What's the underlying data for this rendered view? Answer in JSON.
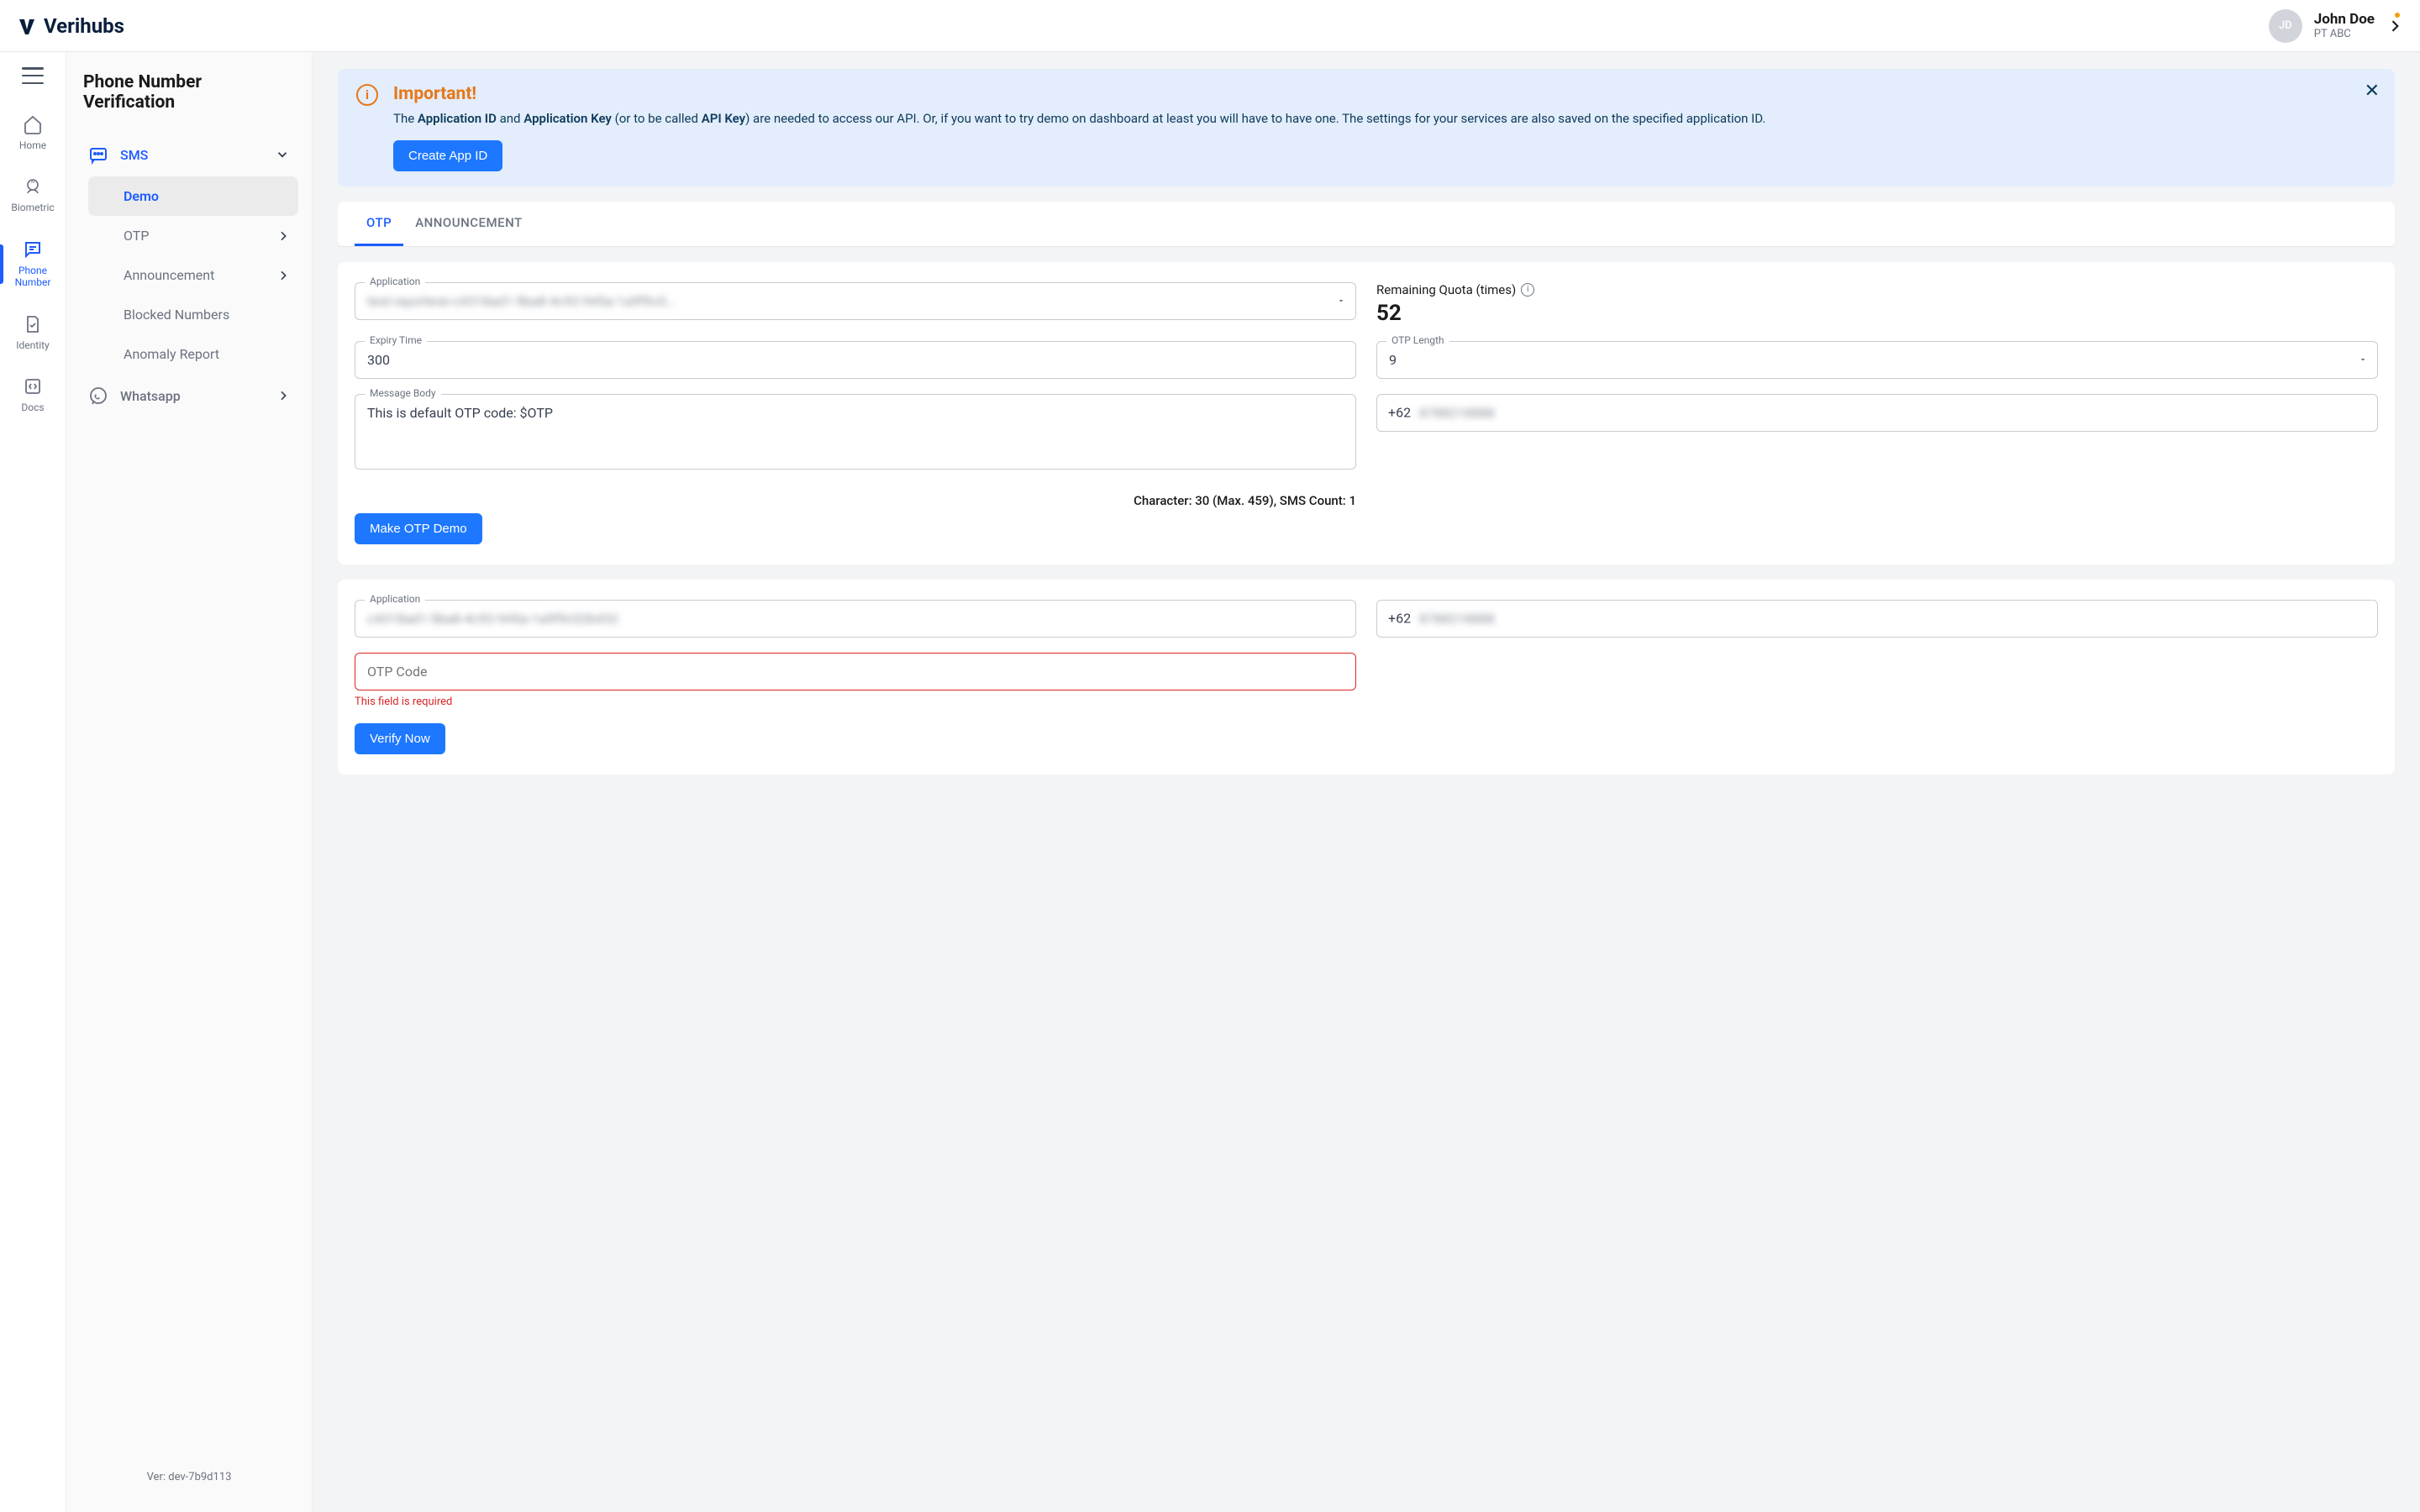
{
  "header": {
    "brand": "Verihubs",
    "user": {
      "initials": "JD",
      "name": "John Doe",
      "company": "PT ABC"
    }
  },
  "rail": {
    "items": [
      {
        "id": "home",
        "label": "Home"
      },
      {
        "id": "biometric",
        "label": "Biometric"
      },
      {
        "id": "phone",
        "label": "Phone Number"
      },
      {
        "id": "identity",
        "label": "Identity"
      },
      {
        "id": "docs",
        "label": "Docs"
      }
    ]
  },
  "sidebar": {
    "title": "Phone Number Verification",
    "groups": {
      "sms": "SMS",
      "whatsapp": "Whatsapp"
    },
    "items": {
      "demo": "Demo",
      "otp": "OTP",
      "announcement": "Announcement",
      "blocked": "Blocked Numbers",
      "anomaly": "Anomaly Report"
    },
    "version": "Ver: dev-7b9d113"
  },
  "alert": {
    "title": "Important!",
    "body_pre": "The ",
    "body_app_id": "Application ID",
    "body_and": " and ",
    "body_app_key": "Application Key",
    "body_or": " (or to be called ",
    "body_api_key": "API Key",
    "body_rest": ") are needed to access our API. Or, if you want to try demo on dashboard at least you will have to have one. The settings for your services are also saved on the specified application ID.",
    "button": "Create App ID"
  },
  "tabs": {
    "otp": "OTP",
    "announcement": "ANNOUNCEMENT"
  },
  "form": {
    "application_label": "Application",
    "application_value": "test-rayorlene-c4318ad1-5ba8-4c92-945a-1a9f9c0...",
    "expiry_label": "Expiry Time",
    "expiry_value": "300",
    "body_label": "Message Body",
    "body_value": "This is default OTP code: $OTP",
    "char_count": "Character: 30 (Max. 459), SMS Count: 1",
    "quota_label": "Remaining Quota (times)",
    "quota_value": "52",
    "otp_len_label": "OTP Length",
    "otp_len_value": "9",
    "phone_prefix": "+62",
    "phone_value": "8788218888",
    "make_button": "Make OTP Demo"
  },
  "verify": {
    "application_label": "Application",
    "application_value": "c4318ad1-5ba8-4c92-945a-1a9f9c02b432",
    "phone_prefix": "+62",
    "phone_value": "8788218888",
    "otp_placeholder": "OTP Code",
    "otp_error": "This field is required",
    "verify_button": "Verify Now"
  }
}
